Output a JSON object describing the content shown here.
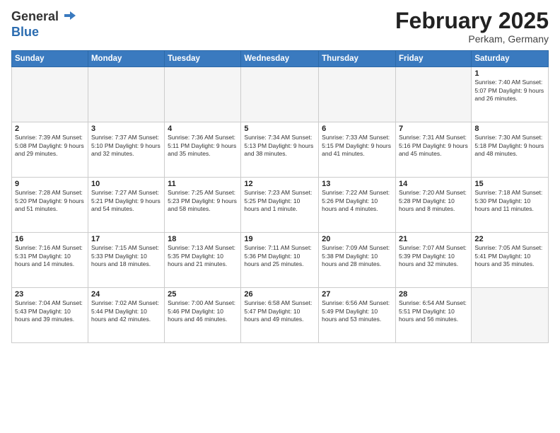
{
  "logo": {
    "general": "General",
    "blue": "Blue"
  },
  "header": {
    "title": "February 2025",
    "subtitle": "Perkam, Germany"
  },
  "weekdays": [
    "Sunday",
    "Monday",
    "Tuesday",
    "Wednesday",
    "Thursday",
    "Friday",
    "Saturday"
  ],
  "weeks": [
    [
      {
        "day": "",
        "info": ""
      },
      {
        "day": "",
        "info": ""
      },
      {
        "day": "",
        "info": ""
      },
      {
        "day": "",
        "info": ""
      },
      {
        "day": "",
        "info": ""
      },
      {
        "day": "",
        "info": ""
      },
      {
        "day": "1",
        "info": "Sunrise: 7:40 AM\nSunset: 5:07 PM\nDaylight: 9 hours and 26 minutes."
      }
    ],
    [
      {
        "day": "2",
        "info": "Sunrise: 7:39 AM\nSunset: 5:08 PM\nDaylight: 9 hours and 29 minutes."
      },
      {
        "day": "3",
        "info": "Sunrise: 7:37 AM\nSunset: 5:10 PM\nDaylight: 9 hours and 32 minutes."
      },
      {
        "day": "4",
        "info": "Sunrise: 7:36 AM\nSunset: 5:11 PM\nDaylight: 9 hours and 35 minutes."
      },
      {
        "day": "5",
        "info": "Sunrise: 7:34 AM\nSunset: 5:13 PM\nDaylight: 9 hours and 38 minutes."
      },
      {
        "day": "6",
        "info": "Sunrise: 7:33 AM\nSunset: 5:15 PM\nDaylight: 9 hours and 41 minutes."
      },
      {
        "day": "7",
        "info": "Sunrise: 7:31 AM\nSunset: 5:16 PM\nDaylight: 9 hours and 45 minutes."
      },
      {
        "day": "8",
        "info": "Sunrise: 7:30 AM\nSunset: 5:18 PM\nDaylight: 9 hours and 48 minutes."
      }
    ],
    [
      {
        "day": "9",
        "info": "Sunrise: 7:28 AM\nSunset: 5:20 PM\nDaylight: 9 hours and 51 minutes."
      },
      {
        "day": "10",
        "info": "Sunrise: 7:27 AM\nSunset: 5:21 PM\nDaylight: 9 hours and 54 minutes."
      },
      {
        "day": "11",
        "info": "Sunrise: 7:25 AM\nSunset: 5:23 PM\nDaylight: 9 hours and 58 minutes."
      },
      {
        "day": "12",
        "info": "Sunrise: 7:23 AM\nSunset: 5:25 PM\nDaylight: 10 hours and 1 minute."
      },
      {
        "day": "13",
        "info": "Sunrise: 7:22 AM\nSunset: 5:26 PM\nDaylight: 10 hours and 4 minutes."
      },
      {
        "day": "14",
        "info": "Sunrise: 7:20 AM\nSunset: 5:28 PM\nDaylight: 10 hours and 8 minutes."
      },
      {
        "day": "15",
        "info": "Sunrise: 7:18 AM\nSunset: 5:30 PM\nDaylight: 10 hours and 11 minutes."
      }
    ],
    [
      {
        "day": "16",
        "info": "Sunrise: 7:16 AM\nSunset: 5:31 PM\nDaylight: 10 hours and 14 minutes."
      },
      {
        "day": "17",
        "info": "Sunrise: 7:15 AM\nSunset: 5:33 PM\nDaylight: 10 hours and 18 minutes."
      },
      {
        "day": "18",
        "info": "Sunrise: 7:13 AM\nSunset: 5:35 PM\nDaylight: 10 hours and 21 minutes."
      },
      {
        "day": "19",
        "info": "Sunrise: 7:11 AM\nSunset: 5:36 PM\nDaylight: 10 hours and 25 minutes."
      },
      {
        "day": "20",
        "info": "Sunrise: 7:09 AM\nSunset: 5:38 PM\nDaylight: 10 hours and 28 minutes."
      },
      {
        "day": "21",
        "info": "Sunrise: 7:07 AM\nSunset: 5:39 PM\nDaylight: 10 hours and 32 minutes."
      },
      {
        "day": "22",
        "info": "Sunrise: 7:05 AM\nSunset: 5:41 PM\nDaylight: 10 hours and 35 minutes."
      }
    ],
    [
      {
        "day": "23",
        "info": "Sunrise: 7:04 AM\nSunset: 5:43 PM\nDaylight: 10 hours and 39 minutes."
      },
      {
        "day": "24",
        "info": "Sunrise: 7:02 AM\nSunset: 5:44 PM\nDaylight: 10 hours and 42 minutes."
      },
      {
        "day": "25",
        "info": "Sunrise: 7:00 AM\nSunset: 5:46 PM\nDaylight: 10 hours and 46 minutes."
      },
      {
        "day": "26",
        "info": "Sunrise: 6:58 AM\nSunset: 5:47 PM\nDaylight: 10 hours and 49 minutes."
      },
      {
        "day": "27",
        "info": "Sunrise: 6:56 AM\nSunset: 5:49 PM\nDaylight: 10 hours and 53 minutes."
      },
      {
        "day": "28",
        "info": "Sunrise: 6:54 AM\nSunset: 5:51 PM\nDaylight: 10 hours and 56 minutes."
      },
      {
        "day": "",
        "info": ""
      }
    ]
  ]
}
